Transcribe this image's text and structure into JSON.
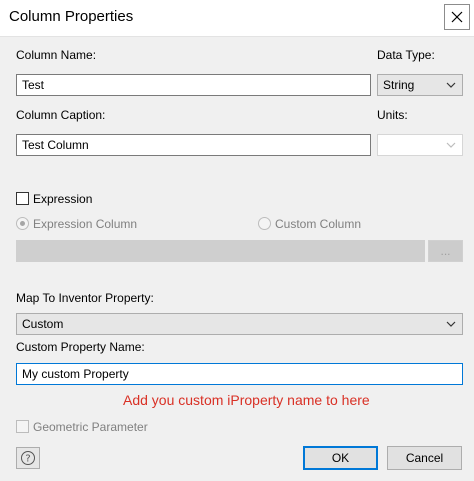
{
  "window": {
    "title": "Column Properties",
    "close_icon": "close-icon"
  },
  "column_name": {
    "label": "Column Name:",
    "value": "Test"
  },
  "data_type": {
    "label": "Data Type:",
    "value": "String"
  },
  "column_caption": {
    "label": "Column Caption:",
    "value": "Test Column"
  },
  "units": {
    "label": "Units:",
    "value": ""
  },
  "expression": {
    "checkbox_label": "Expression",
    "checked": false,
    "expression_column_label": "Expression Column",
    "custom_column_label": "Custom Column",
    "browse_label": "...",
    "value": ""
  },
  "map_property": {
    "label": "Map To Inventor Property:",
    "value": "Custom"
  },
  "custom_property": {
    "label": "Custom Property Name:",
    "value": "My custom Property"
  },
  "annotation": {
    "text": "Add you custom iProperty name to here",
    "color": "#d93025"
  },
  "geometric": {
    "label": "Geometric Parameter",
    "checked": false
  },
  "buttons": {
    "ok": "OK",
    "cancel": "Cancel",
    "help_icon": "help-icon"
  }
}
